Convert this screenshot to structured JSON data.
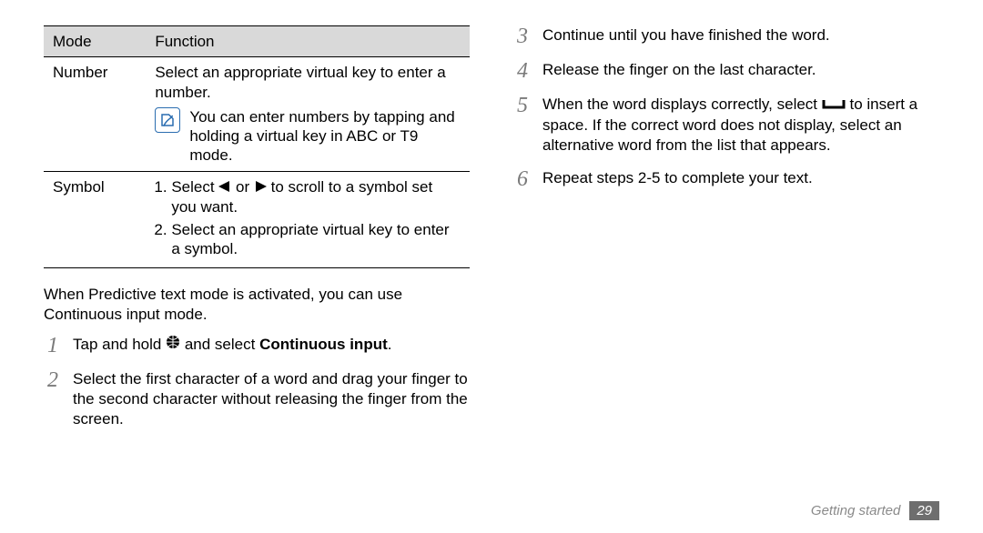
{
  "table": {
    "headers": {
      "mode": "Mode",
      "function": "Function"
    },
    "rows": [
      {
        "mode": "Number",
        "function_main": "Select an appropriate virtual key to enter a number.",
        "note": "You can enter numbers by tapping and holding a virtual key in ABC or T9 mode."
      },
      {
        "mode": "Symbol",
        "function_items": [
          {
            "pre": "Select ",
            "mid": " or ",
            "post": " to scroll to a symbol set you want."
          },
          "Select an appropriate virtual key to enter a symbol."
        ]
      }
    ]
  },
  "paragraph": "When Predictive text mode is activated, you can use Continuous input mode.",
  "left_steps": [
    {
      "n": "1",
      "pre": "Tap and hold ",
      "post": " and select ",
      "bold": "Continuous input",
      "tail": "."
    },
    {
      "n": "2",
      "text": "Select the first character of a word and drag your finger to the second character without releasing the finger from the screen."
    }
  ],
  "right_steps": [
    {
      "n": "3",
      "text": "Continue until you have finished the word."
    },
    {
      "n": "4",
      "text": "Release the finger on the last character."
    },
    {
      "n": "5",
      "pre": "When the word displays correctly, select ",
      "post": " to insert a space. If the correct word does not display, select an alternative word from the list that appears."
    },
    {
      "n": "6",
      "text": "Repeat steps 2-5 to complete your text."
    }
  ],
  "footer": {
    "section": "Getting started",
    "page": "29"
  }
}
